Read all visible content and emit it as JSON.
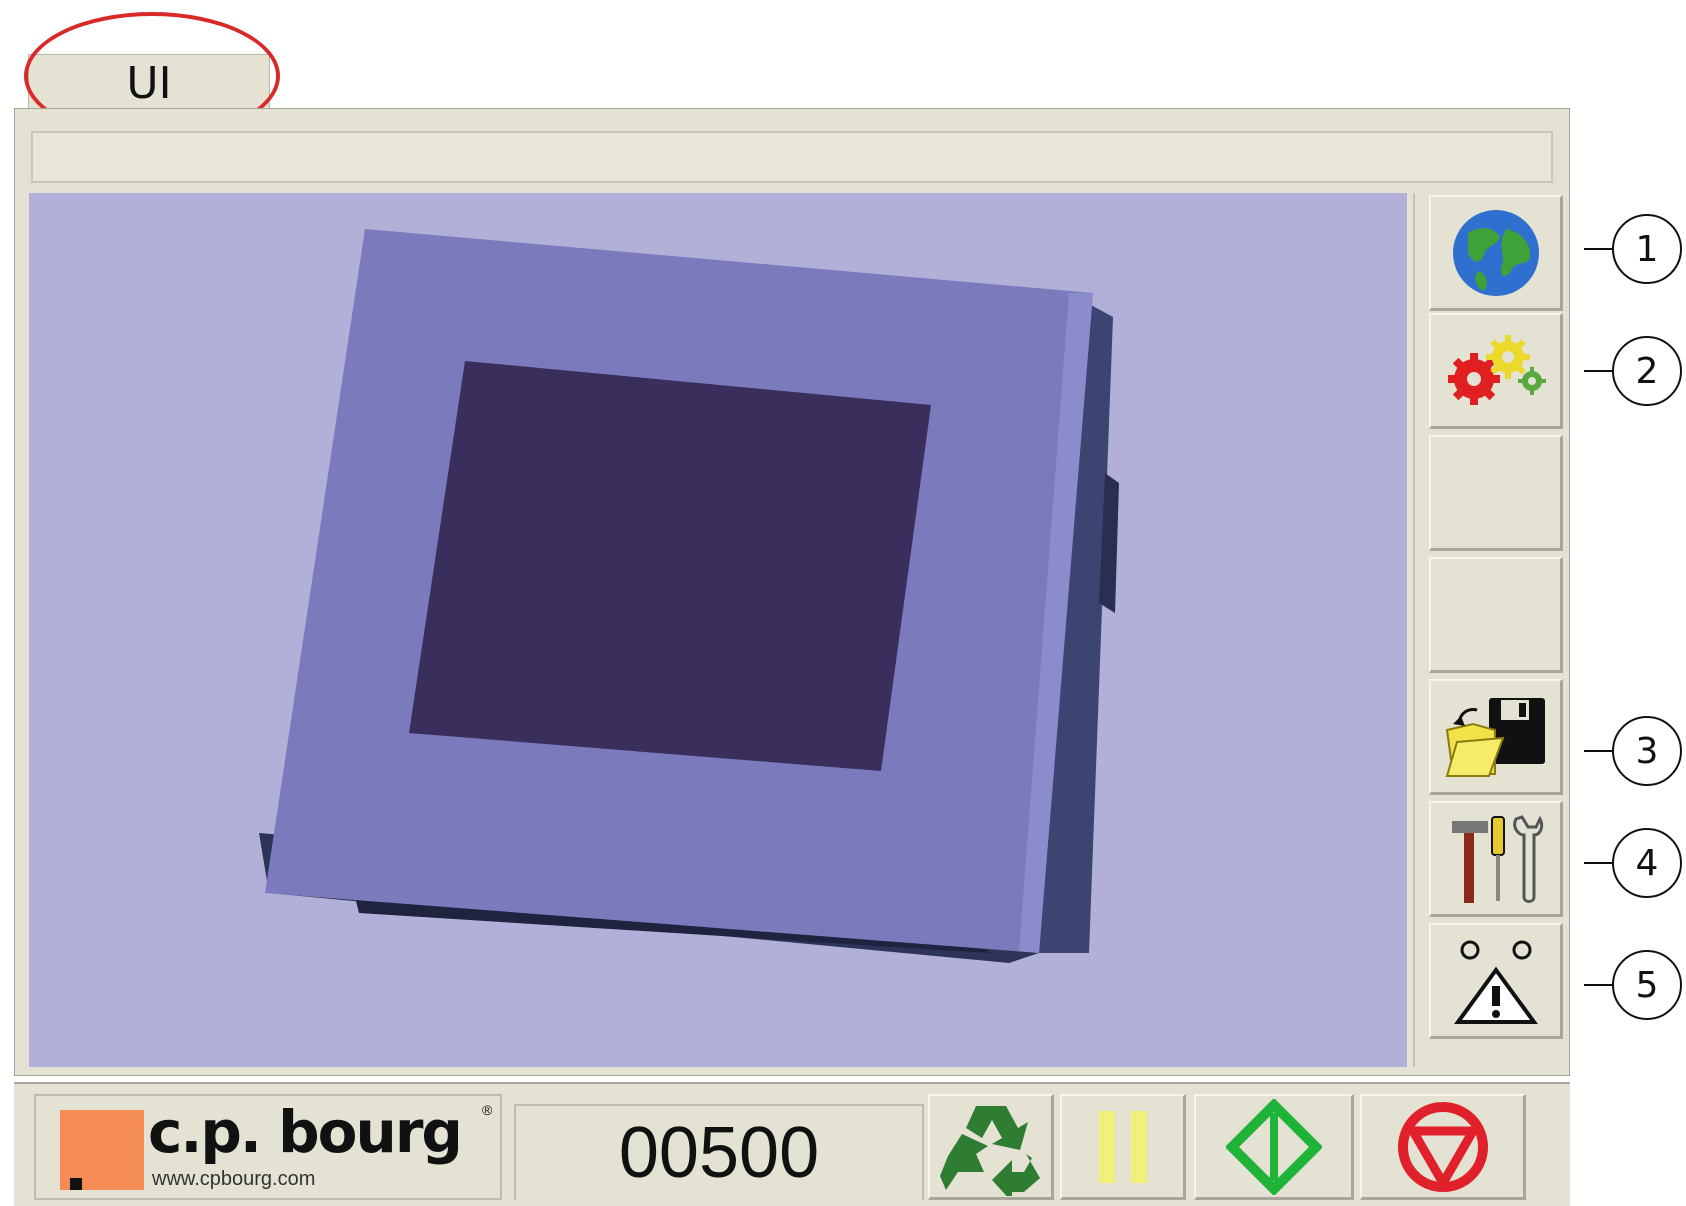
{
  "tab": {
    "label": "UI",
    "highlight_color": "#d92a2a"
  },
  "viewport": {
    "background": "#b2b0d9",
    "device_image": "touchscreen-panel"
  },
  "side_buttons": [
    {
      "icon": "globe-icon",
      "callout": "1"
    },
    {
      "icon": "gears-icon",
      "callout": "2"
    },
    {
      "icon": "",
      "callout": ""
    },
    {
      "icon": "",
      "callout": ""
    },
    {
      "icon": "open-save-icon",
      "callout": "3"
    },
    {
      "icon": "tools-icon",
      "callout": "4"
    },
    {
      "icon": "alarm-warning-icon",
      "callout": "5"
    }
  ],
  "footer": {
    "logo_text": "c.p. bourg",
    "logo_reg": "®",
    "logo_url": "www.cpbourg.com",
    "counter": "00500",
    "buttons": [
      "recycle-icon",
      "pause-icon",
      "start-icon",
      "stop-icon"
    ],
    "colors": {
      "logo_orange": "#f58c55",
      "recycle_green": "#2f7d32",
      "pause_yellow": "#f2ef7a",
      "start_green": "#1fb33a",
      "stop_red": "#e0202a"
    }
  }
}
